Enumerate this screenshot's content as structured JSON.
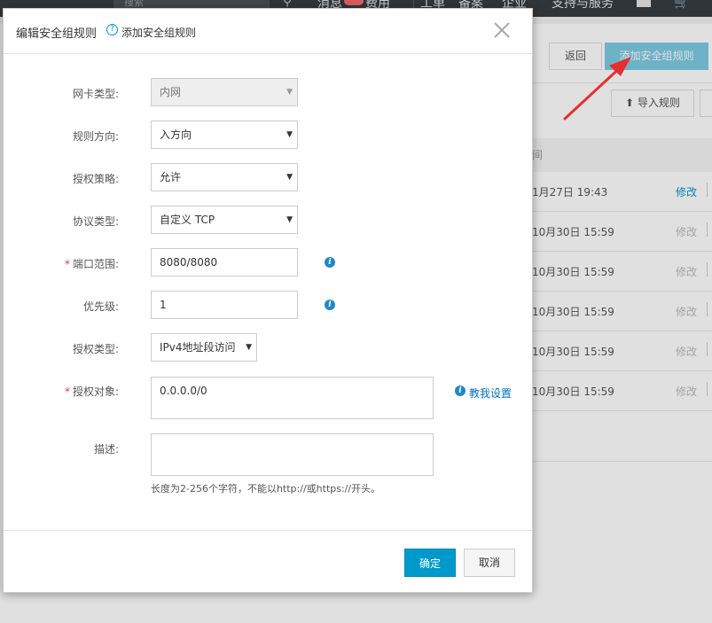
{
  "topbar": {
    "search_placeholder": "搜索",
    "nav": [
      "消息",
      "费用",
      "工单",
      "备案",
      "企业",
      "支持与服务"
    ]
  },
  "background": {
    "back_label": "返回",
    "add_rule_label": "添加安全组规则",
    "import_label": "导入规则",
    "table_header": "间",
    "rows": [
      {
        "date": "1月27日 19:43",
        "edit": "修改"
      },
      {
        "date": "10月30日 15:59",
        "edit": "修改"
      },
      {
        "date": "10月30日 15:59",
        "edit": "修改"
      },
      {
        "date": "10月30日 15:59",
        "edit": "修改"
      },
      {
        "date": "10月30日 15:59",
        "edit": "修改"
      },
      {
        "date": "10月30日 15:59",
        "edit": "修改"
      }
    ]
  },
  "modal": {
    "title": "编辑安全组规则",
    "help_link": "添加安全组规则",
    "fields": {
      "nic_type": {
        "label": "网卡类型:",
        "value": "内网"
      },
      "direction": {
        "label": "规则方向:",
        "value": "入方向"
      },
      "policy": {
        "label": "授权策略:",
        "value": "允许"
      },
      "protocol": {
        "label": "协议类型:",
        "value": "自定义 TCP"
      },
      "port_range": {
        "label": "端口范围:",
        "value": "8080/8080"
      },
      "priority": {
        "label": "优先级:",
        "value": "1"
      },
      "auth_type": {
        "label": "授权类型:",
        "value": "IPv4地址段访问"
      },
      "auth_object": {
        "label": "授权对象:",
        "value": "0.0.0.0/0"
      },
      "description": {
        "label": "描述:",
        "value": ""
      }
    },
    "tutorial_link": "教我设置",
    "hint": "长度为2-256个字符，不能以http://或https://开头。",
    "ok_label": "确定",
    "cancel_label": "取消"
  },
  "colors": {
    "primary": "#0099cc",
    "required": "#e4393c",
    "accent_button": "#7dcbe3",
    "arrow": "#e62e2e"
  }
}
